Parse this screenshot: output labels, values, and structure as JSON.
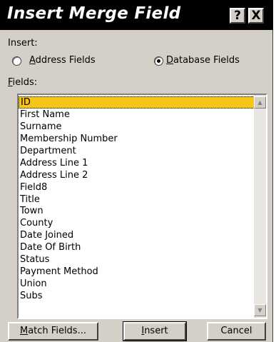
{
  "window": {
    "title": "Insert Merge Field",
    "help_glyph": "?",
    "close_glyph": "X"
  },
  "insert_group": {
    "label": "Insert:",
    "options": [
      {
        "accel": "A",
        "rest": "ddress Fields",
        "selected": false
      },
      {
        "accel": "D",
        "rest": "atabase Fields",
        "selected": true
      }
    ]
  },
  "fields": {
    "label_accel": "F",
    "label_rest": "ields:",
    "items": [
      "ID",
      "First Name",
      "Surname",
      "Membership Number",
      "Department",
      "Address Line 1",
      "Address Line 2",
      "Field8",
      "Title",
      "Town",
      "County",
      "Date Joined",
      "Date Of Birth",
      "Status",
      "Payment Method",
      "Union",
      "Subs"
    ],
    "selected_index": 0
  },
  "buttons": {
    "match_fields": {
      "accel": "M",
      "rest": "atch Fields..."
    },
    "insert": {
      "accel": "I",
      "rest": "nsert"
    },
    "cancel": "Cancel"
  },
  "scrollbar": {
    "up_icon": "up-arrow-icon",
    "down_icon": "down-arrow-icon"
  },
  "colors": {
    "titlebar": "#000000",
    "face": "#d4d0c8",
    "selection": "#f5c518"
  }
}
